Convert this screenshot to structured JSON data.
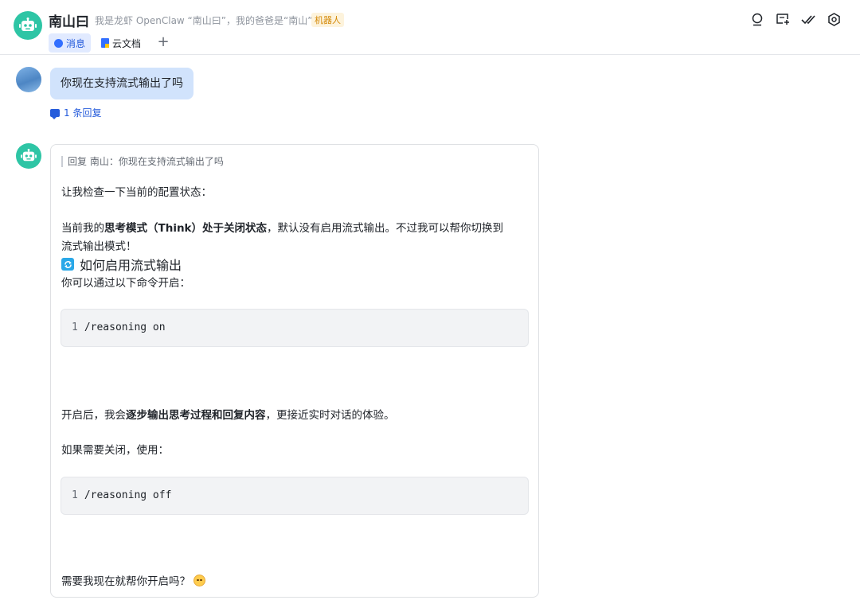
{
  "header": {
    "title": "南山曰",
    "description": "我是龙虾 OpenClaw “南山曰”，我的爸爸是“南山”",
    "badge": "机器人",
    "tabs": [
      {
        "label": "消息",
        "icon": "message-icon"
      },
      {
        "label": "云文档",
        "icon": "doc-icon"
      }
    ],
    "add_tab": "+",
    "actions": [
      "search-icon",
      "add-chat-icon",
      "double-check-icon",
      "settings-icon"
    ]
  },
  "messages": {
    "user_message": {
      "text": "你现在支持流式输出了吗",
      "reply_count": "1 条回复"
    },
    "bot_reply": {
      "quote": "回复 南山：你现在支持流式输出了吗",
      "p1": "让我检查一下当前的配置状态：",
      "p2a": "当前我的",
      "p2b": "思考模式（Think）处于关闭状态",
      "p2c": "，默认没有启用流式输出。不过我可以帮你切换到",
      "p2d": "流式输出模式！",
      "heading": "如何启用流式输出",
      "p3": "你可以通过以下命令开启：",
      "code1_line": "1",
      "code1": "/reasoning on",
      "p4a": "开启后，我会",
      "p4b": "逐步输出思考过程和回复内容",
      "p4c": "，更接近实时对话的体验。",
      "p5": "如果需要关闭，使用：",
      "code2_line": "1",
      "code2": "/reasoning off",
      "p6": "需要我现在就帮你开启吗？"
    }
  },
  "colors": {
    "brand_teal": "#2ec5a5",
    "link_blue": "#245bdb",
    "bubble_blue": "#d1e3fc",
    "badge_orange": "#d48806"
  }
}
